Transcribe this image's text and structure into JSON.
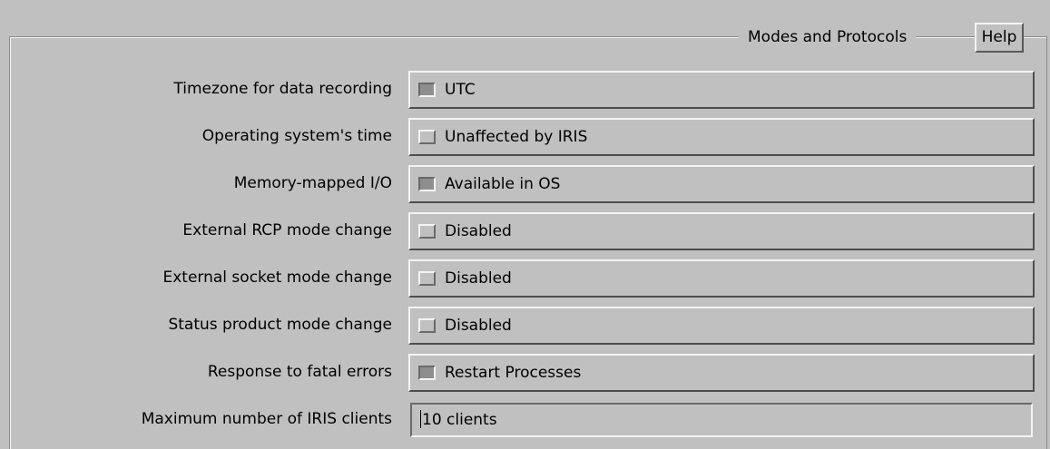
{
  "panel": {
    "title": "Modes and Protocols",
    "help_label": "Help"
  },
  "settings": [
    {
      "label": "Timezone for data recording",
      "value": "UTC",
      "indicator": "on"
    },
    {
      "label": "Operating system's time",
      "value": "Unaffected by IRIS",
      "indicator": "off"
    },
    {
      "label": "Memory-mapped I/O",
      "value": "Available in OS",
      "indicator": "on"
    },
    {
      "label": "External RCP mode change",
      "value": "Disabled",
      "indicator": "off"
    },
    {
      "label": "External socket mode change",
      "value": "Disabled",
      "indicator": "off"
    },
    {
      "label": "Status product mode change",
      "value": "Disabled",
      "indicator": "off"
    },
    {
      "label": "Response to fatal errors",
      "value": "Restart Processes",
      "indicator": "on"
    }
  ],
  "max_clients": {
    "label": "Maximum number of IRIS clients",
    "value": "10 clients"
  },
  "colors": {
    "background": "#c0c0c0",
    "indicator_on": "#8e8e8e"
  }
}
